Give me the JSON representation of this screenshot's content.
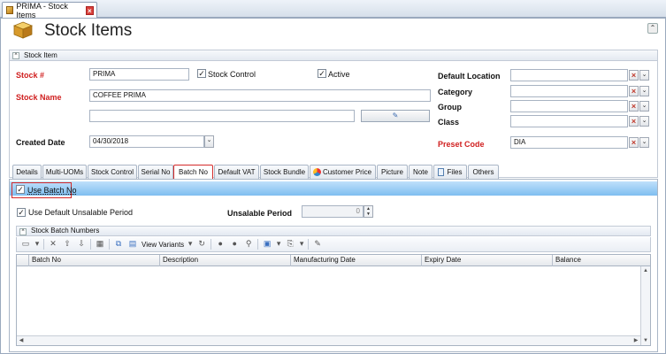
{
  "window": {
    "tab_title": "PRIMA - Stock Items",
    "page_title": "Stock Items"
  },
  "stock_item": {
    "group_label": "Stock Item",
    "stock_no_label": "Stock #",
    "stock_no": "PRIMA",
    "stock_control_label": "Stock Control",
    "active_label": "Active",
    "stock_name_label": "Stock Name",
    "stock_name": "COFFEE PRIMA",
    "stock_name2": "",
    "created_date_label": "Created Date",
    "created_date": "04/30/2018",
    "default_location_label": "Default Location",
    "default_location": "",
    "category_label": "Category",
    "category": "",
    "group_field_label": "Group",
    "group": "",
    "class_label": "Class",
    "class": "",
    "preset_code_label": "Preset Code",
    "preset_code": "DIA"
  },
  "tabs": [
    "Details",
    "Multi-UOMs",
    "Stock Control",
    "Serial No",
    "Batch No",
    "Default VAT",
    "Stock Bundle",
    "Customer Price",
    "Picture",
    "Note",
    "Files",
    "Others"
  ],
  "active_tab": "Batch No",
  "batch": {
    "use_batch_no_label": "Use Batch No",
    "use_default_unsalable_label": "Use Default Unsalable Period",
    "unsalable_period_label": "Unsalable Period",
    "unsalable_period_value": "0",
    "section_title": "Stock Batch Numbers",
    "view_variants_label": "View Variants",
    "columns": [
      "Batch No",
      "Description",
      "Manufacturing Date",
      "Expiry Date",
      "Balance"
    ]
  },
  "colors": {
    "required_label": "#d02020",
    "highlight_bar": "#7fbef0",
    "callout": "#d42a2a"
  }
}
